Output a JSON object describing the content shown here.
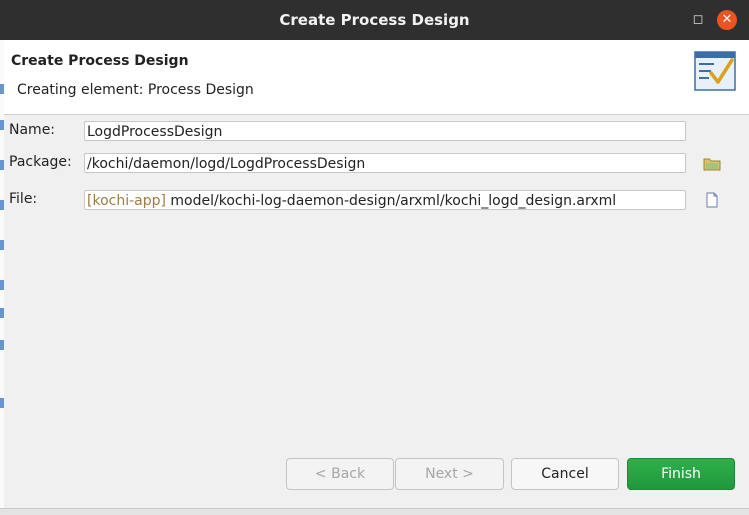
{
  "window": {
    "title": "Create Process Design"
  },
  "header": {
    "title": "Create Process Design",
    "message": "Creating element: Process Design"
  },
  "form": {
    "name_label": "Name:",
    "name_value": "LogdProcessDesign",
    "package_label": "Package:",
    "package_value": "/kochi/daemon/logd/LogdProcessDesign",
    "file_label": "File:",
    "file_prefix": "[kochi-app]",
    "file_value": " model/kochi-log-daemon-design/arxml/kochi_logd_design.arxml"
  },
  "buttons": {
    "back": "< Back",
    "next": "Next >",
    "cancel": "Cancel",
    "finish": "Finish"
  },
  "colors": {
    "titlebar": "#2f2f2f",
    "close": "#e95420",
    "finish": "#28a745",
    "file_prefix": "#9b7d44"
  },
  "icons": {
    "package_browse": "folder-icon",
    "file_browse": "document-icon",
    "banner": "wizard-checklist-icon"
  }
}
